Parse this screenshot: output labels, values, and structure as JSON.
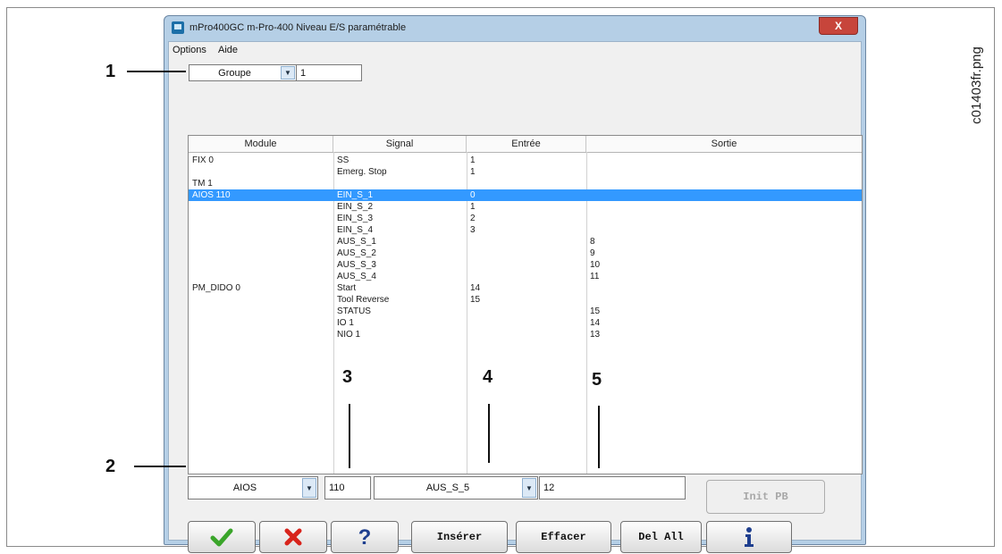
{
  "window": {
    "title": "mPro400GC m-Pro-400  Niveau E/S paramétrable",
    "close_label": "X"
  },
  "menu": {
    "items": [
      "Options",
      "Aide"
    ]
  },
  "filter": {
    "combo_value": "Groupe",
    "input_value": "1"
  },
  "table": {
    "columns": [
      "Module",
      "Signal",
      "Entrée",
      "Sortie"
    ],
    "rows": [
      {
        "module": "FIX 0",
        "signal": "SS",
        "entree": "1",
        "sortie": "",
        "selected": false
      },
      {
        "module": "",
        "signal": "Emerg. Stop",
        "entree": "1",
        "sortie": "",
        "selected": false
      },
      {
        "module": "TM 1",
        "signal": "",
        "entree": "",
        "sortie": "",
        "selected": false
      },
      {
        "module": "AIOS 110",
        "signal": "EIN_S_1",
        "entree": "0",
        "sortie": "",
        "selected": true
      },
      {
        "module": "",
        "signal": "EIN_S_2",
        "entree": "1",
        "sortie": "",
        "selected": false
      },
      {
        "module": "",
        "signal": "EIN_S_3",
        "entree": "2",
        "sortie": "",
        "selected": false
      },
      {
        "module": "",
        "signal": "EIN_S_4",
        "entree": "3",
        "sortie": "",
        "selected": false
      },
      {
        "module": "",
        "signal": "AUS_S_1",
        "entree": "",
        "sortie": "8",
        "selected": false
      },
      {
        "module": "",
        "signal": "AUS_S_2",
        "entree": "",
        "sortie": "9",
        "selected": false
      },
      {
        "module": "",
        "signal": "AUS_S_3",
        "entree": "",
        "sortie": "10",
        "selected": false
      },
      {
        "module": "",
        "signal": "AUS_S_4",
        "entree": "",
        "sortie": "11",
        "selected": false
      },
      {
        "module": "PM_DIDO 0",
        "signal": "Start",
        "entree": "14",
        "sortie": "",
        "selected": false
      },
      {
        "module": "",
        "signal": "Tool Reverse",
        "entree": "15",
        "sortie": "",
        "selected": false
      },
      {
        "module": "",
        "signal": "STATUS",
        "entree": "",
        "sortie": "15",
        "selected": false
      },
      {
        "module": "",
        "signal": "IO 1",
        "entree": "",
        "sortie": "14",
        "selected": false
      },
      {
        "module": "",
        "signal": "NIO 1",
        "entree": "",
        "sortie": "13",
        "selected": false
      }
    ]
  },
  "editor": {
    "module_combo": "AIOS",
    "module_number": "110",
    "signal_combo": "AUS_S_5",
    "io_value": "12",
    "init_label": "Init PB"
  },
  "buttons": {
    "insert": "Insérer",
    "erase": "Effacer",
    "delall": "Del All"
  },
  "callouts": [
    "1",
    "2",
    "3",
    "4",
    "5"
  ],
  "image_label": "c01403fr.png",
  "colors": {
    "selection": "#3399ff",
    "ok_icon": "#3aa52a",
    "cancel_icon": "#d8241c",
    "help_icon": "#1f3f8f"
  },
  "icons": {
    "ok": "checkmark-icon",
    "cancel": "cross-icon",
    "help": "question-icon",
    "info": "info-icon"
  }
}
